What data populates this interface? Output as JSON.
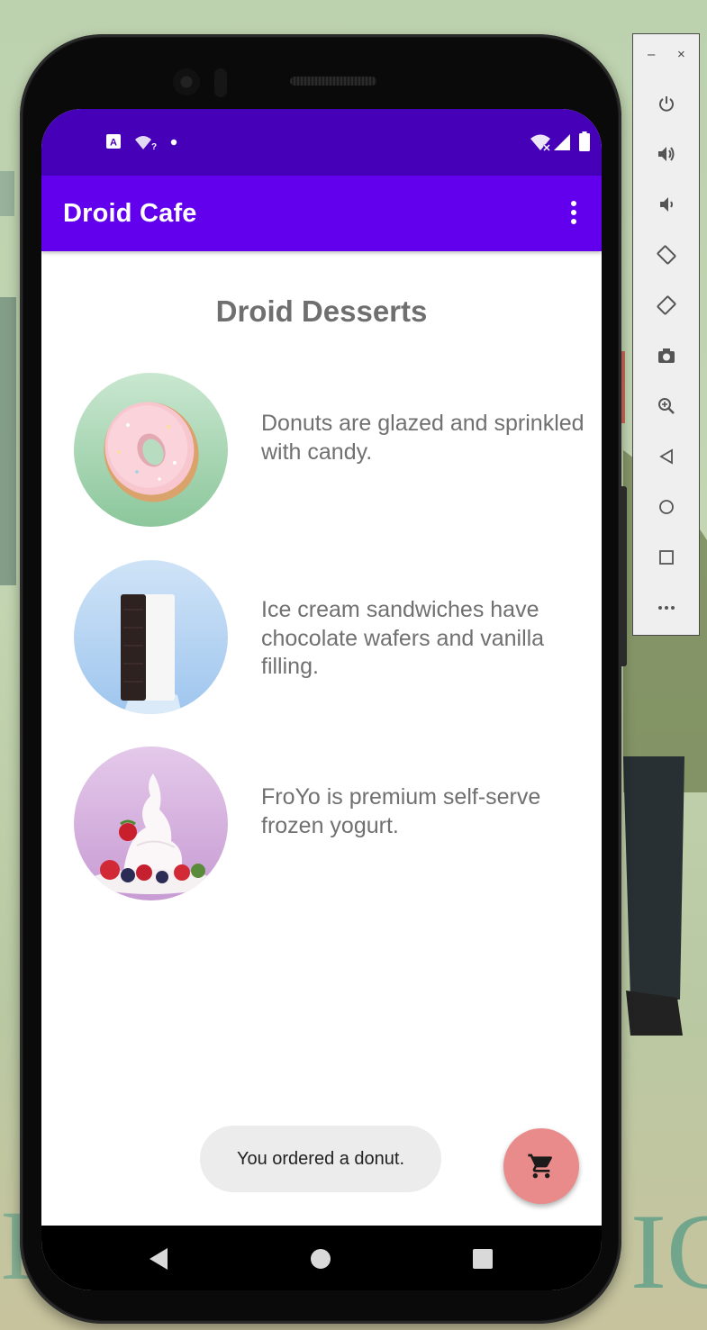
{
  "status_bar": {
    "left_icons": [
      "translate-icon",
      "wifi-question-icon",
      "dot-icon"
    ],
    "right_icons": [
      "wifi-off-icon",
      "cellular-icon",
      "battery-icon"
    ]
  },
  "app_bar": {
    "title": "Droid Cafe",
    "overflow_icon": "more-vert-icon"
  },
  "main": {
    "heading": "Droid Desserts",
    "items": [
      {
        "image": "donut-image",
        "description": "Donuts are glazed and sprinkled with candy."
      },
      {
        "image": "ice-cream-sandwich-image",
        "description": "Ice cream sandwiches have chocolate wafers and vanilla filling."
      },
      {
        "image": "froyo-image",
        "description": "FroYo is premium self-serve frozen yogurt."
      }
    ]
  },
  "toast": {
    "message": "You ordered a donut."
  },
  "fab": {
    "icon": "shopping-cart-icon",
    "color": "#ea8b8b"
  },
  "nav_bar": {
    "buttons": [
      "back-icon",
      "home-icon",
      "recents-icon"
    ]
  },
  "colors": {
    "primary": "#6200ee",
    "primary_dark": "#4500b8",
    "accent_fab": "#ea8b8b"
  },
  "emulator_panel": {
    "window_controls": [
      "minimize-icon",
      "close-icon"
    ],
    "buttons": [
      "power-icon",
      "volume-up-icon",
      "volume-down-icon",
      "rotate-left-icon",
      "rotate-right-icon",
      "camera-icon",
      "zoom-icon",
      "back-icon",
      "home-icon",
      "overview-icon",
      "more-icon"
    ]
  }
}
